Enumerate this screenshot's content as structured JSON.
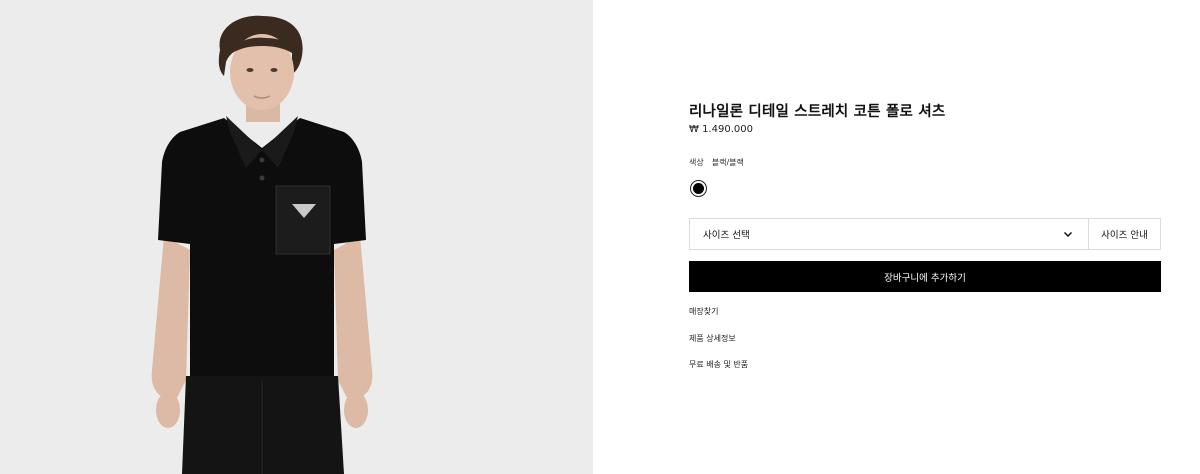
{
  "product": {
    "title": "리나일론 디테일 스트레치 코튼 폴로 셔츠",
    "price": "₩ 1.490.000",
    "color_label": "색상",
    "color_value": "블랙/블랙",
    "swatch_color": "#000000"
  },
  "size": {
    "select_label": "사이즈 선택",
    "guide_label": "사이즈 안내"
  },
  "cart": {
    "button_label": "장바구니에 추가하기"
  },
  "links": [
    {
      "label": "매장찾기"
    },
    {
      "label": "제품 상세정보"
    },
    {
      "label": "무료 배송 및 반품"
    }
  ],
  "colors": {
    "image_background": "#ececec",
    "primary_button": "#000000"
  }
}
